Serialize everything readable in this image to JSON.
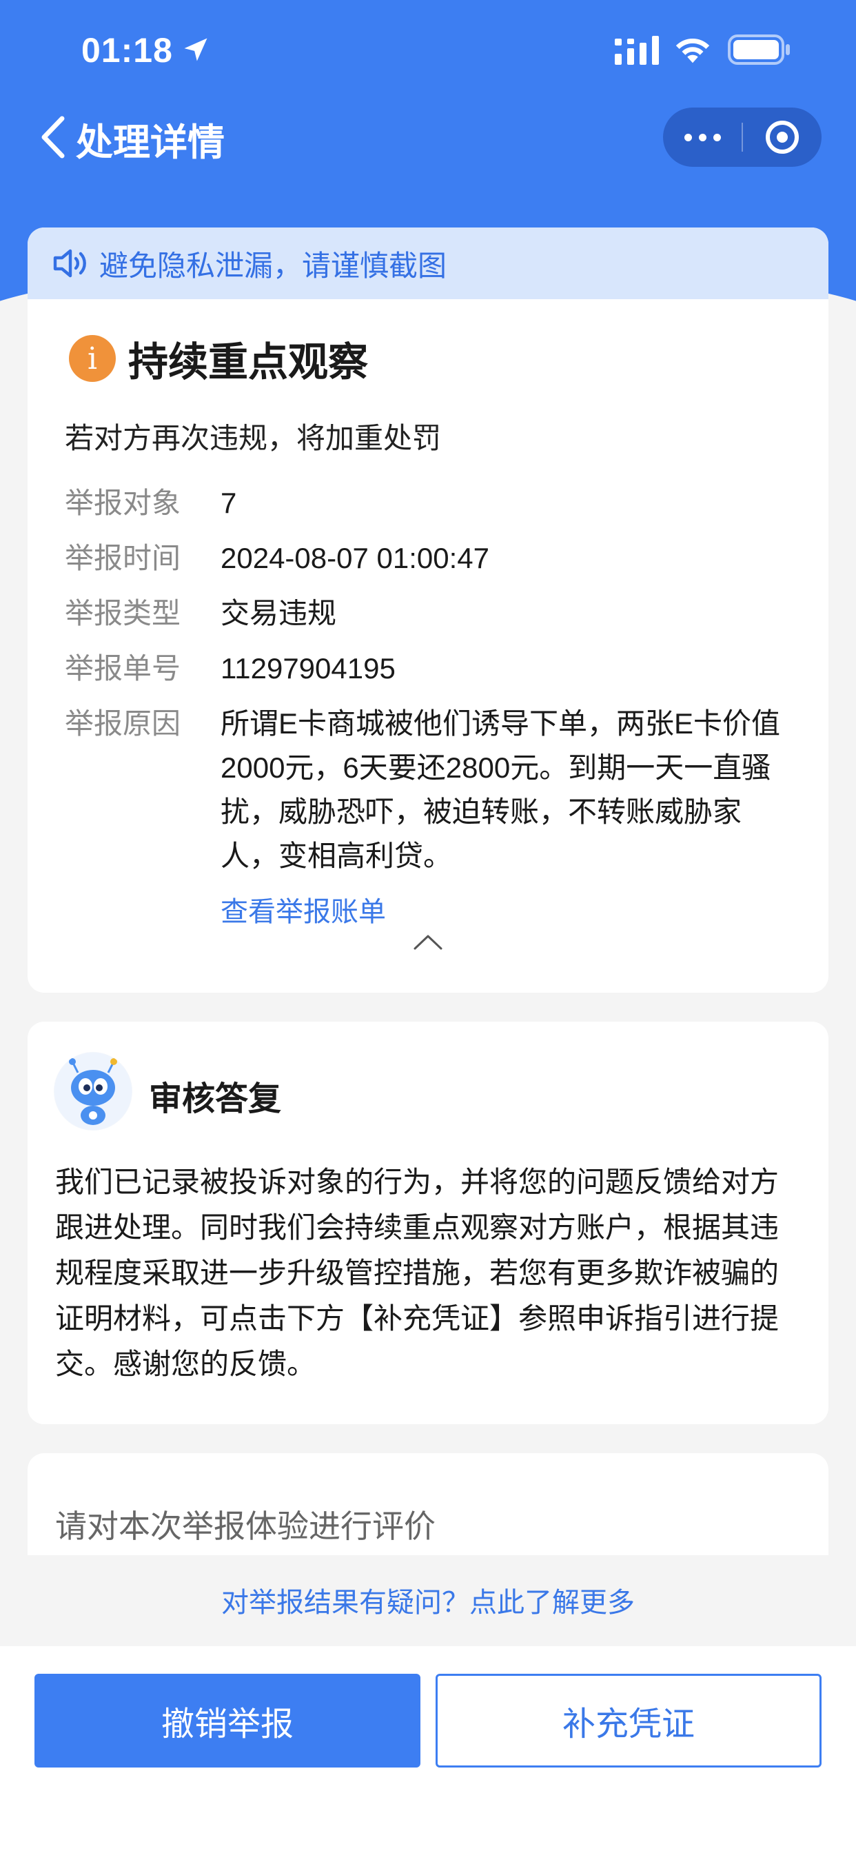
{
  "status_bar": {
    "time": "01:18",
    "icons": [
      "location-arrow-icon",
      "signal-icon",
      "wifi-icon",
      "battery-icon"
    ]
  },
  "nav": {
    "title": "处理详情",
    "back_icon": "chevron-left-icon",
    "more_icon": "more-dots-icon",
    "close_icon": "target-close-icon"
  },
  "privacy_banner": {
    "icon": "speaker-icon",
    "text": "避免隐私泄漏，请谨慎截图"
  },
  "status": {
    "icon": "info-icon",
    "icon_glyph": "i",
    "title": "持续重点观察",
    "subtitle": "若对方再次违规，将加重处罚"
  },
  "report": {
    "rows": [
      {
        "label": "举报对象",
        "value": "7"
      },
      {
        "label": "举报时间",
        "value": "2024-08-07 01:00:47"
      },
      {
        "label": "举报类型",
        "value": "交易违规"
      },
      {
        "label": "举报单号",
        "value": "11297904195"
      },
      {
        "label": "举报原因",
        "value": "所谓E卡商城被他们诱导下单，两张E卡价值2000元，6天要还2800元。到期一天一直骚扰，威胁恐吓，被迫转账，不转账威胁家人，变相高利贷。"
      }
    ],
    "view_bill_link": "查看举报账单",
    "collapse_icon": "chevron-up-icon"
  },
  "reply": {
    "avatar": "robot-mascot-avatar",
    "title": "审核答复",
    "body": "我们已记录被投诉对象的行为，并将您的问题反馈给对方跟进处理。同时我们会持续重点观察对方账户，根据其违规程度采取进一步升级管控措施，若您有更多欺诈被骗的证明材料，可点击下方【补充凭证】参照申诉指引进行提交。感谢您的反馈。"
  },
  "rating": {
    "prompt": "请对本次举报体验进行评价"
  },
  "question_link": "对举报结果有疑问？点此了解更多",
  "buttons": {
    "revoke": "撤销举报",
    "supplement": "补充凭证"
  },
  "colors": {
    "brand_blue": "#3d7ef2",
    "link_blue": "#3a78e8",
    "warning_orange": "#f0923a",
    "banner_bg": "#d8e6fc"
  }
}
